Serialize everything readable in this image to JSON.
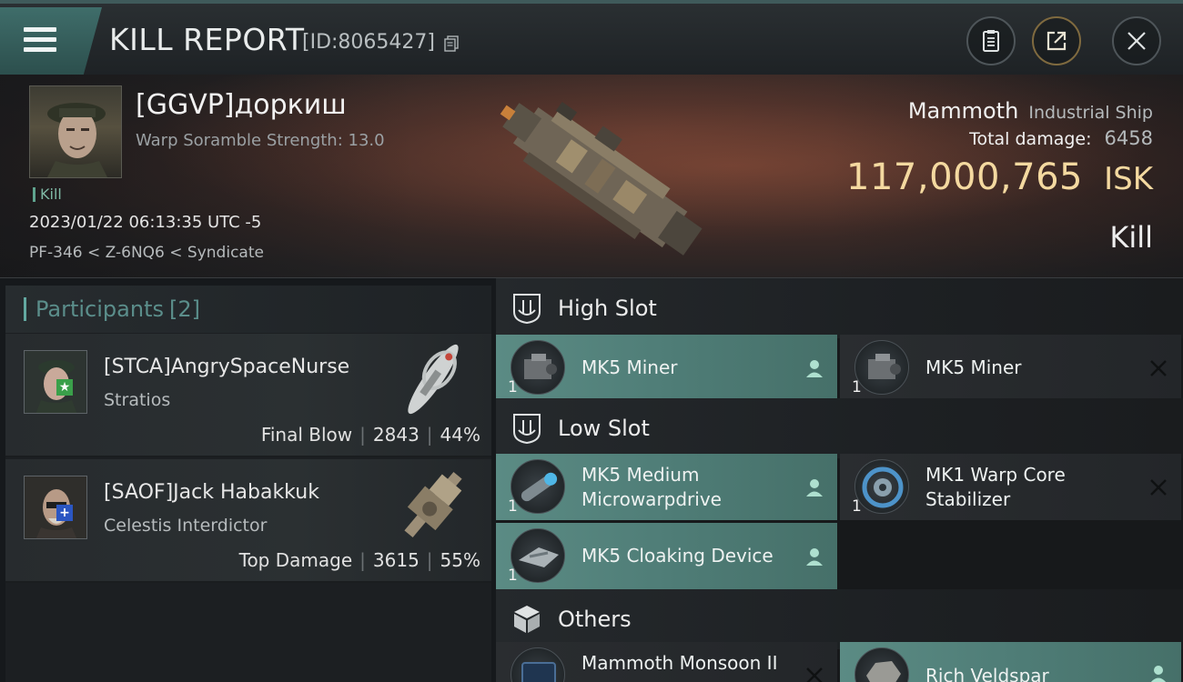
{
  "header": {
    "title": "KILL REPORT",
    "id_label": "[ID:8065427]",
    "icons": [
      "menu-icon",
      "copy-icon",
      "clipboard-icon",
      "share-icon",
      "close-icon"
    ]
  },
  "victim": {
    "name": "[GGVP]доркиш",
    "scramble": "Warp Soramble Strength: 13.0",
    "tag": "Kill",
    "datetime": "2023/01/22 06:13:35 UTC -5",
    "location": "PF-346 < Z-6NQ6 < Syndicate",
    "ship_name": "Mammoth",
    "ship_class": "Industrial Ship",
    "damage_label": "Total damage:",
    "damage_value": "6458",
    "isk_value": "117,000,765",
    "isk_unit": "ISK",
    "result": "Kill"
  },
  "participants": {
    "title": "Participants",
    "count": "[2]",
    "items": [
      {
        "name": "[STCA]AngrySpaceNurse",
        "ship": "Stratios",
        "role": "Final Blow",
        "damage": "2843",
        "percent": "44%",
        "badge": "★",
        "badge_color": "#3aa04a"
      },
      {
        "name": "[SAOF]Jack Habakkuk",
        "ship": "Celestis Interdictor",
        "role": "Top Damage",
        "damage": "3615",
        "percent": "55%",
        "badge": "+",
        "badge_color": "#2b56c2"
      }
    ]
  },
  "fittings": {
    "high": {
      "label": "High Slot",
      "modules": [
        {
          "name": "MK5 Miner",
          "qty": "1",
          "state": "dropped"
        },
        {
          "name": "MK5 Miner",
          "qty": "1",
          "state": "destroyed"
        }
      ]
    },
    "low": {
      "label": "Low Slot",
      "modules": [
        {
          "name": "MK5 Medium Microwarpdrive",
          "qty": "1",
          "state": "dropped"
        },
        {
          "name": "MK1 Warp Core Stabilizer",
          "qty": "1",
          "state": "destroyed"
        },
        {
          "name": "MK5 Cloaking Device",
          "qty": "1",
          "state": "dropped"
        }
      ]
    },
    "others": {
      "label": "Others",
      "modules": [
        {
          "name": "Mammoth Monsoon II",
          "state": "destroyed"
        },
        {
          "name": "Rich Veldspar",
          "state": "dropped"
        }
      ]
    }
  },
  "colors": {
    "accent_teal": "#5b8b84",
    "isk_gold": "#f4d9a0",
    "destroyed_bg": "#2a2d30"
  }
}
